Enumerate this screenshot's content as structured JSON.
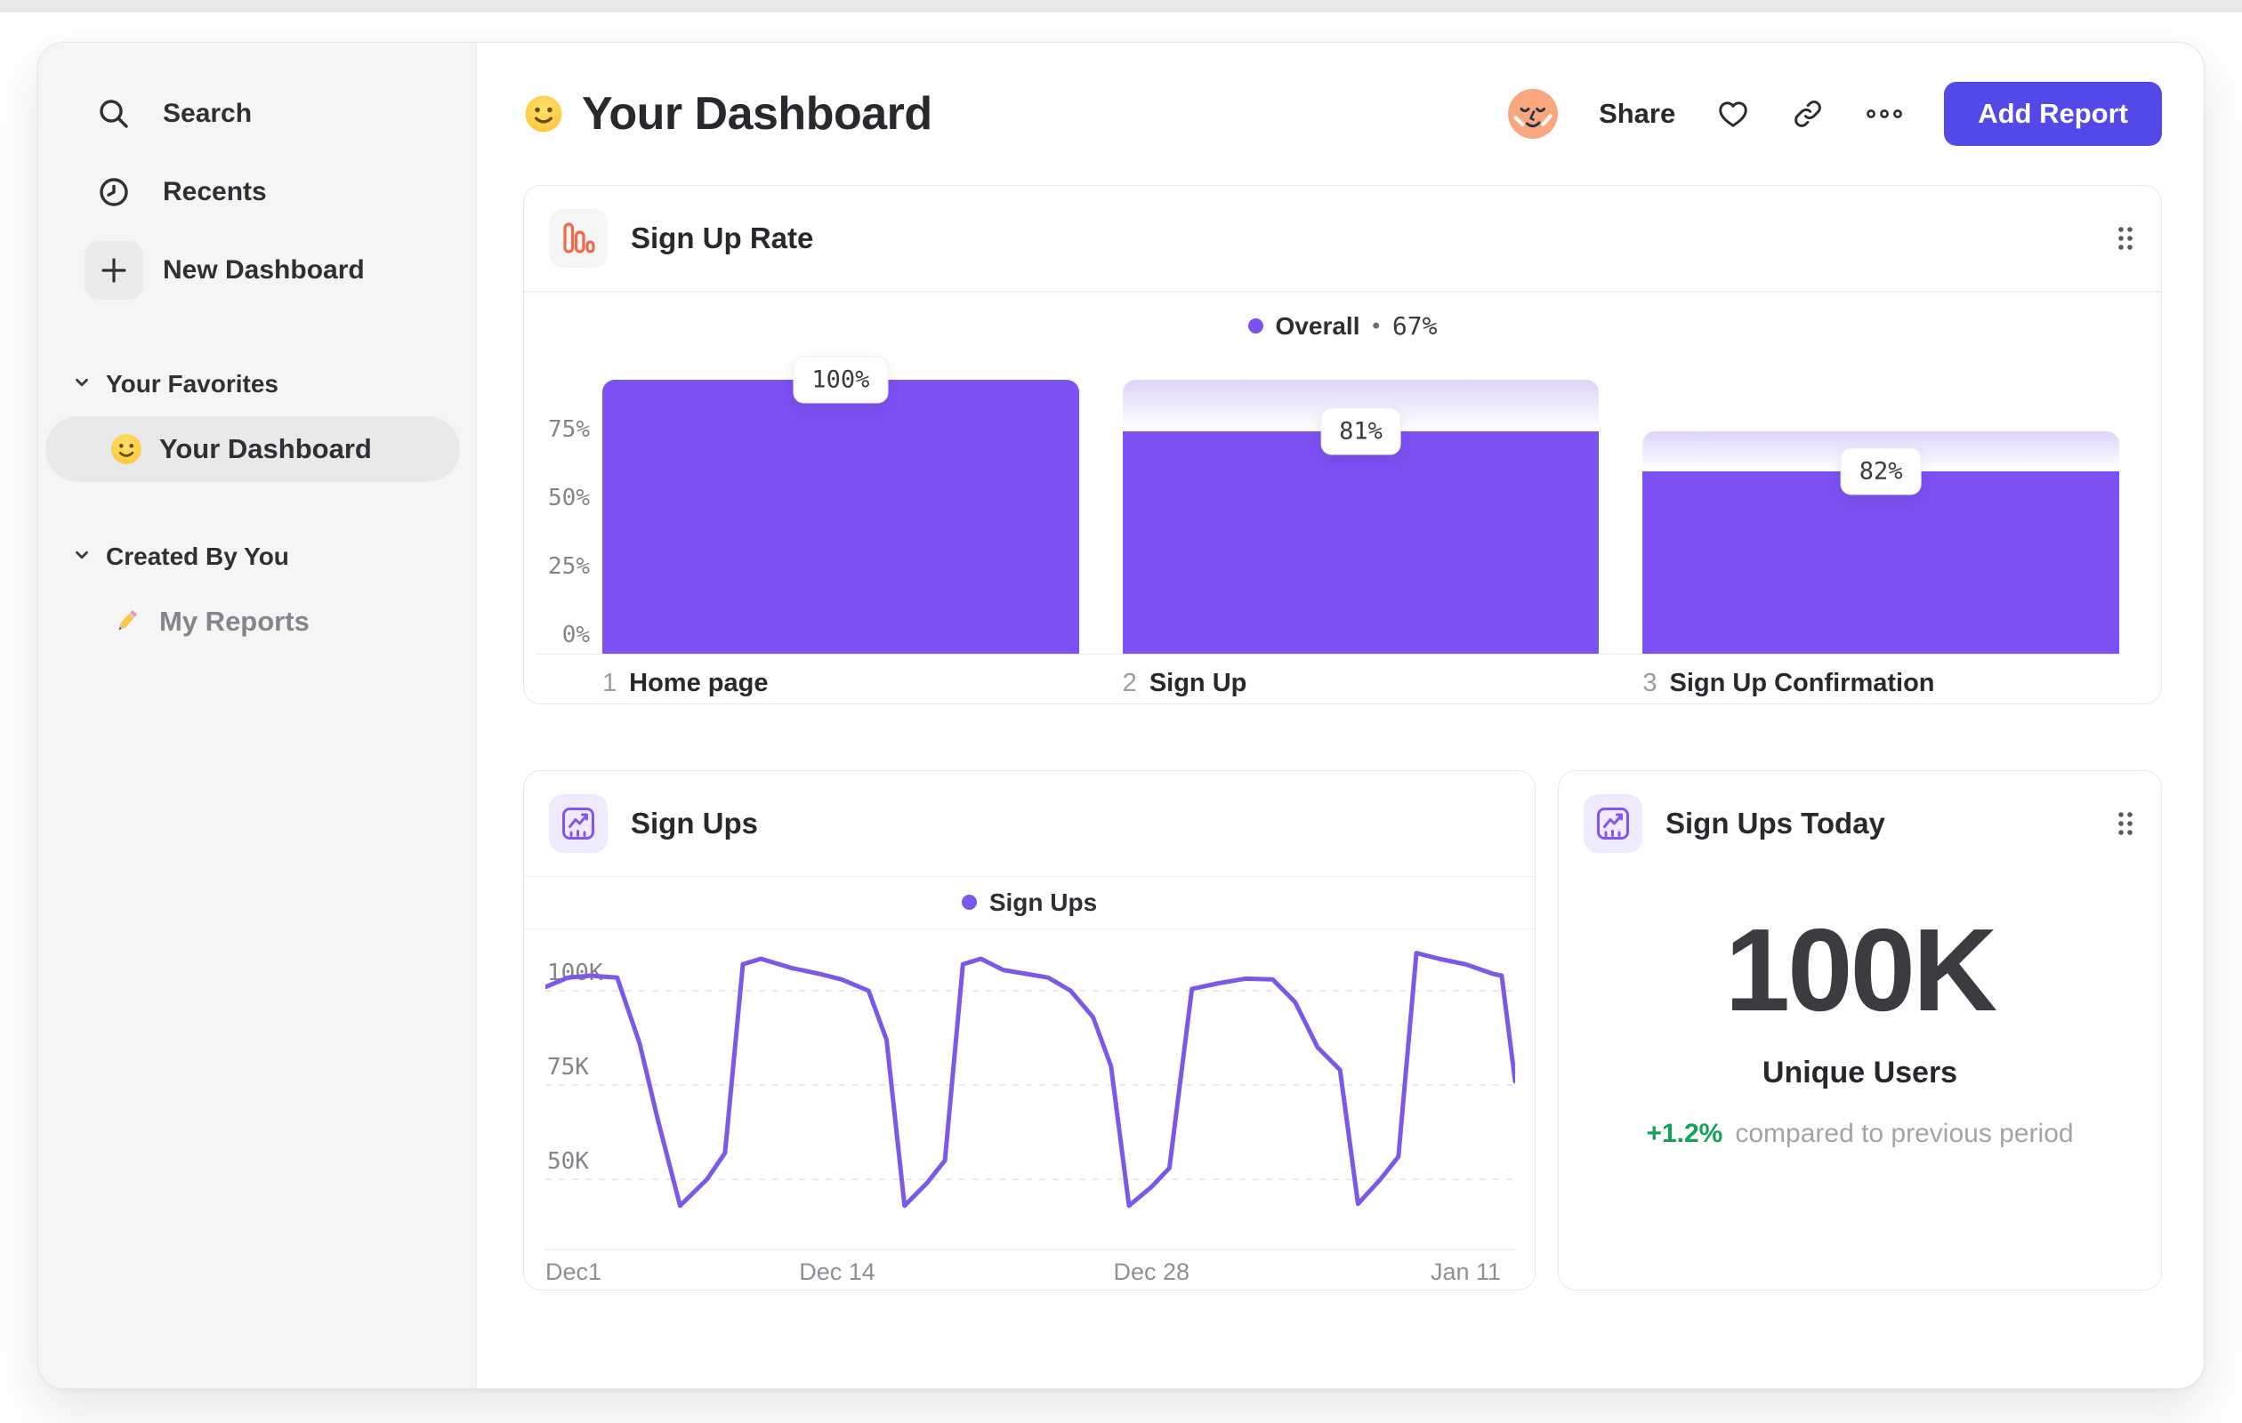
{
  "header": {
    "title": "Your Dashboard",
    "share_label": "Share",
    "add_report_label": "Add Report"
  },
  "sidebar": {
    "nav": [
      {
        "id": "search",
        "label": "Search",
        "icon": "search-icon"
      },
      {
        "id": "recents",
        "label": "Recents",
        "icon": "clock-icon"
      },
      {
        "id": "new-dashboard",
        "label": "New Dashboard",
        "icon": "plus-icon",
        "boxed": true
      }
    ],
    "sections": [
      {
        "label": "Your Favorites",
        "items": [
          {
            "label": "Your Dashboard",
            "emoji": "smiley",
            "active": true,
            "muted": false
          }
        ]
      },
      {
        "label": "Created By You",
        "items": [
          {
            "label": "My Reports",
            "emoji": "pencil",
            "active": false,
            "muted": true
          }
        ]
      }
    ]
  },
  "chart_data": [
    {
      "type": "bar",
      "subtype": "funnel",
      "title": "Sign Up Rate",
      "legend": {
        "label": "Overall",
        "separator": "•",
        "value": "67%"
      },
      "legend_position": "top-center",
      "grid": "off",
      "ylim": [
        0,
        100
      ],
      "yticks": [
        {
          "label": "75%",
          "value": 75
        },
        {
          "label": "50%",
          "value": 50
        },
        {
          "label": "25%",
          "value": 25
        },
        {
          "label": "0%",
          "value": 0
        }
      ],
      "steps": [
        {
          "index": "1",
          "label": "Home page",
          "overall_pct": 100,
          "from_pct": 100,
          "value_label": "100%"
        },
        {
          "index": "2",
          "label": "Sign Up",
          "overall_pct": 81,
          "from_pct": 100,
          "value_label": "81%"
        },
        {
          "index": "3",
          "label": "Sign Up Confirmation",
          "overall_pct": 66.4,
          "from_pct": 81,
          "value_label": "82%"
        }
      ],
      "colors": {
        "bar": "#7c50f2",
        "gradient_top": "#ddd3f9"
      }
    },
    {
      "type": "line",
      "title": "Sign Ups",
      "legend": {
        "label": "Sign Ups"
      },
      "legend_position": "top-center",
      "grid": "dashed-horizontal",
      "y_unit": "K",
      "ylim": [
        40,
        112
      ],
      "yticks": [
        {
          "label": "100K",
          "value": 100
        },
        {
          "label": "75K",
          "value": 75
        },
        {
          "label": "50K",
          "value": 50
        }
      ],
      "xticks": [
        {
          "label": "Dec1",
          "day": 0
        },
        {
          "label": "Dec 14",
          "day": 13
        },
        {
          "label": "Dec 28",
          "day": 27
        },
        {
          "label": "Jan 11",
          "day": 41
        }
      ],
      "x_range_days": [
        0,
        43.2
      ],
      "series": [
        {
          "name": "Sign Ups",
          "color": "#7b58ea",
          "points_day_value": [
            [
              0,
              101
            ],
            [
              1,
              103.5
            ],
            [
              2,
              104
            ],
            [
              3.2,
              103.5
            ],
            [
              4.2,
              86
            ],
            [
              5,
              66
            ],
            [
              6,
              43
            ],
            [
              7.2,
              50
            ],
            [
              8,
              57
            ],
            [
              8.8,
              107
            ],
            [
              9.6,
              108.5
            ],
            [
              11,
              106
            ],
            [
              12.2,
              104.5
            ],
            [
              13.2,
              103
            ],
            [
              14.4,
              100
            ],
            [
              15.2,
              87
            ],
            [
              16,
              43
            ],
            [
              17,
              49
            ],
            [
              17.8,
              55
            ],
            [
              18.6,
              107
            ],
            [
              19.4,
              108.5
            ],
            [
              20.4,
              105.5
            ],
            [
              21.4,
              104.5
            ],
            [
              22.4,
              103.5
            ],
            [
              23.4,
              100
            ],
            [
              24.4,
              93
            ],
            [
              25.2,
              80
            ],
            [
              26,
              43
            ],
            [
              27,
              48
            ],
            [
              27.8,
              53
            ],
            [
              28.8,
              100.5
            ],
            [
              30,
              102
            ],
            [
              31.2,
              103.2
            ],
            [
              32.4,
              103
            ],
            [
              33.4,
              97
            ],
            [
              34.4,
              85
            ],
            [
              35.4,
              79
            ],
            [
              36.2,
              43.5
            ],
            [
              37.2,
              50
            ],
            [
              38,
              56
            ],
            [
              38.8,
              110
            ],
            [
              39.8,
              108.5
            ],
            [
              41,
              107
            ],
            [
              42.2,
              104.5
            ],
            [
              42.6,
              104
            ],
            [
              43.2,
              76
            ]
          ]
        }
      ]
    },
    {
      "type": "stat",
      "title": "Sign Ups Today",
      "value": "100K",
      "value_label": "Unique Users",
      "delta": "+1.2%",
      "delta_color": "#13a159",
      "note": "compared to previous period"
    }
  ]
}
